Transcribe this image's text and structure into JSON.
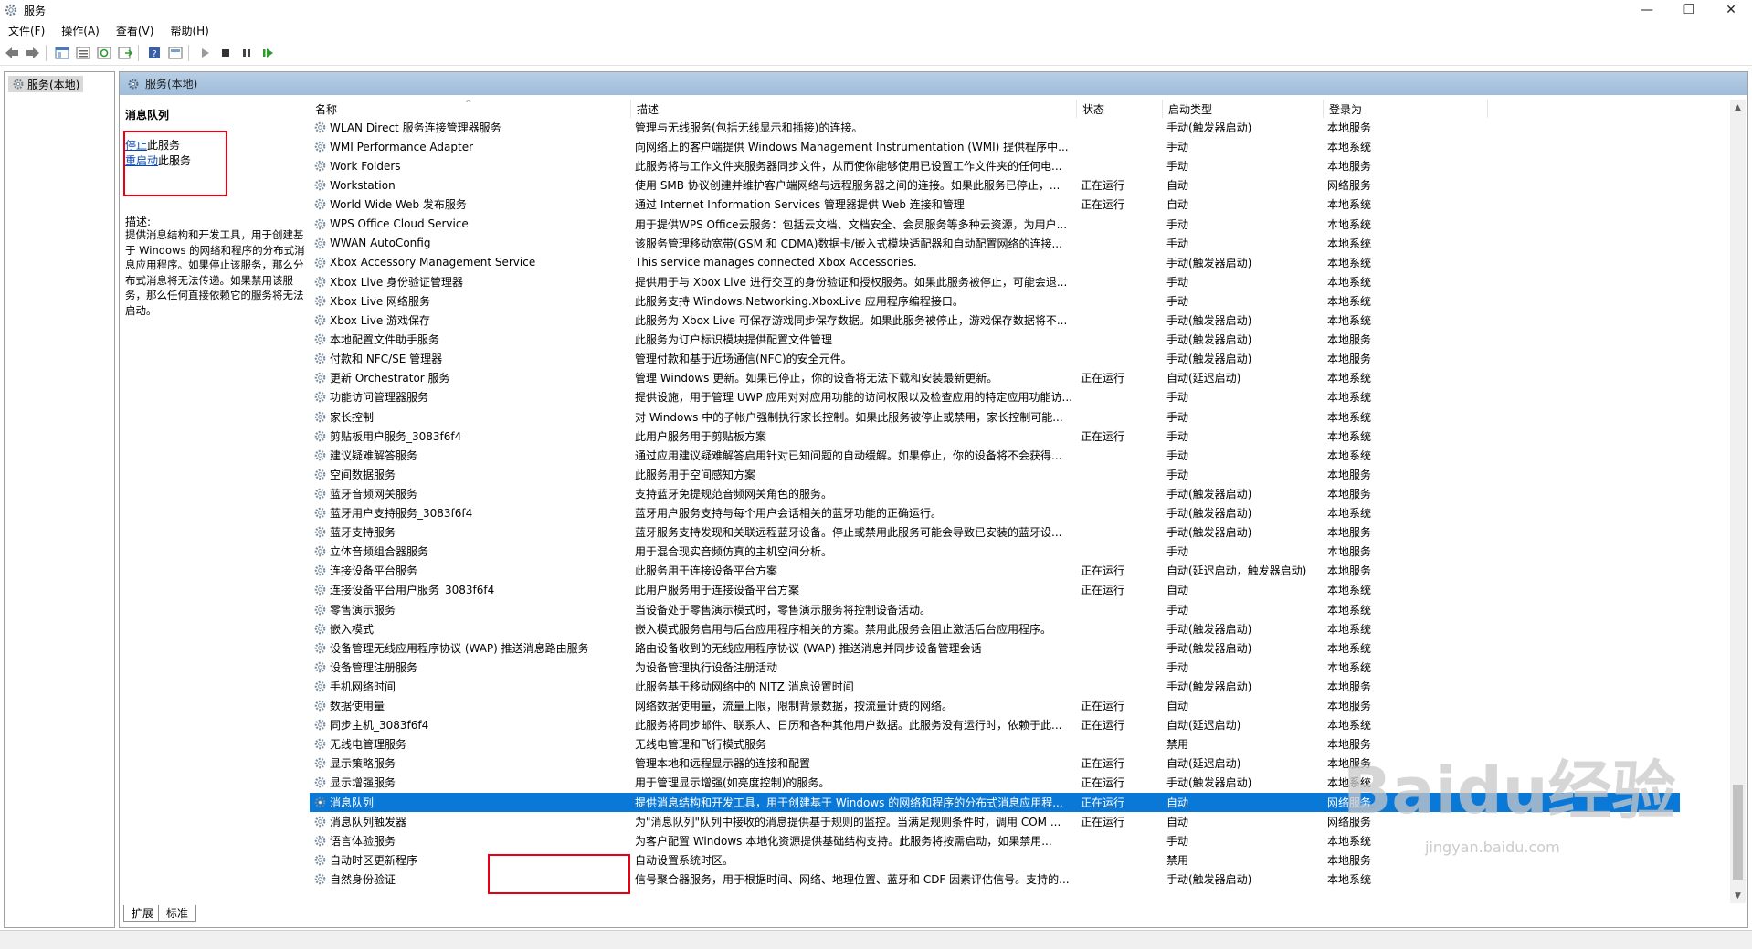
{
  "window": {
    "title": "服务",
    "minimize": "—",
    "restore": "❐",
    "close": "✕"
  },
  "menu": [
    "文件(F)",
    "操作(A)",
    "查看(V)",
    "帮助(H)"
  ],
  "tree": {
    "root_label": "服务(本地)"
  },
  "main": {
    "header_title": "服务(本地)"
  },
  "extended": {
    "selected_name": "消息队列",
    "stop_link": "停止",
    "stop_suffix": "此服务",
    "restart_link": "重启动",
    "restart_suffix": "此服务",
    "desc_label": "描述:",
    "description": "提供消息结构和开发工具，用于创建基于 Windows 的网络和程序的分布式消息应用程序。如果停止该服务，那么分布式消息将无法传递。如果禁用该服务，那么任何直接依赖它的服务将无法启动。"
  },
  "columns": {
    "name": "名称",
    "description": "描述",
    "status": "状态",
    "startup": "启动类型",
    "logon": "登录为"
  },
  "rows": [
    {
      "name": "WLAN Direct 服务连接管理器服务",
      "desc": "管理与无线服务(包括无线显示和插接)的连接。",
      "status": "",
      "startup": "手动(触发器启动)",
      "logon": "本地服务"
    },
    {
      "name": "WMI Performance Adapter",
      "desc": "向网络上的客户端提供 Windows Management Instrumentation (WMI) 提供程序中...",
      "status": "",
      "startup": "手动",
      "logon": "本地系统"
    },
    {
      "name": "Work Folders",
      "desc": "此服务将与工作文件夹服务器同步文件，从而使你能够使用已设置工作文件夹的任何电...",
      "status": "",
      "startup": "手动",
      "logon": "本地服务"
    },
    {
      "name": "Workstation",
      "desc": "使用 SMB 协议创建并维护客户端网络与远程服务器之间的连接。如果此服务已停止，...",
      "status": "正在运行",
      "startup": "自动",
      "logon": "网络服务"
    },
    {
      "name": "World Wide Web 发布服务",
      "desc": "通过 Internet Information Services 管理器提供 Web 连接和管理",
      "status": "正在运行",
      "startup": "自动",
      "logon": "本地系统"
    },
    {
      "name": "WPS Office Cloud Service",
      "desc": "用于提供WPS Office云服务：包括云文档、文档安全、会员服务等多种云资源，为用户...",
      "status": "",
      "startup": "手动",
      "logon": "本地系统"
    },
    {
      "name": "WWAN AutoConfig",
      "desc": "该服务管理移动宽带(GSM 和 CDMA)数据卡/嵌入式模块适配器和自动配置网络的连接...",
      "status": "",
      "startup": "手动",
      "logon": "本地系统"
    },
    {
      "name": "Xbox Accessory Management Service",
      "desc": "This service manages connected Xbox Accessories.",
      "status": "",
      "startup": "手动(触发器启动)",
      "logon": "本地系统"
    },
    {
      "name": "Xbox Live 身份验证管理器",
      "desc": "提供用于与 Xbox Live 进行交互的身份验证和授权服务。如果此服务被停止，可能会退...",
      "status": "",
      "startup": "手动",
      "logon": "本地系统"
    },
    {
      "name": "Xbox Live 网络服务",
      "desc": "此服务支持 Windows.Networking.XboxLive 应用程序编程接口。",
      "status": "",
      "startup": "手动",
      "logon": "本地系统"
    },
    {
      "name": "Xbox Live 游戏保存",
      "desc": "此服务为 Xbox Live 可保存游戏同步保存数据。如果此服务被停止，游戏保存数据将不...",
      "status": "",
      "startup": "手动(触发器启动)",
      "logon": "本地系统"
    },
    {
      "name": "本地配置文件助手服务",
      "desc": "此服务为订户标识模块提供配置文件管理",
      "status": "",
      "startup": "手动(触发器启动)",
      "logon": "本地服务"
    },
    {
      "name": "付款和 NFC/SE 管理器",
      "desc": "管理付款和基于近场通信(NFC)的安全元件。",
      "status": "",
      "startup": "手动(触发器启动)",
      "logon": "本地服务"
    },
    {
      "name": "更新 Orchestrator 服务",
      "desc": "管理 Windows 更新。如果已停止，你的设备将无法下载和安装最新更新。",
      "status": "正在运行",
      "startup": "自动(延迟启动)",
      "logon": "本地系统"
    },
    {
      "name": "功能访问管理器服务",
      "desc": "提供设施，用于管理 UWP 应用对对应用功能的访问权限以及检查应用的特定应用功能访...",
      "status": "",
      "startup": "手动",
      "logon": "本地系统"
    },
    {
      "name": "家长控制",
      "desc": "对 Windows 中的子帐户强制执行家长控制。如果此服务被停止或禁用，家长控制可能...",
      "status": "",
      "startup": "手动",
      "logon": "本地系统"
    },
    {
      "name": "剪贴板用户服务_3083f6f4",
      "desc": "此用户服务用于剪贴板方案",
      "status": "正在运行",
      "startup": "手动",
      "logon": "本地系统"
    },
    {
      "name": "建议疑难解答服务",
      "desc": "通过应用建议疑难解答启用针对已知问题的自动缓解。如果停止，你的设备将不会获得...",
      "status": "",
      "startup": "手动",
      "logon": "本地系统"
    },
    {
      "name": "空间数据服务",
      "desc": "此服务用于空间感知方案",
      "status": "",
      "startup": "手动",
      "logon": "本地服务"
    },
    {
      "name": "蓝牙音频网关服务",
      "desc": "支持蓝牙免提规范音频网关角色的服务。",
      "status": "",
      "startup": "手动(触发器启动)",
      "logon": "本地服务"
    },
    {
      "name": "蓝牙用户支持服务_3083f6f4",
      "desc": "蓝牙用户服务支持与每个用户会话相关的蓝牙功能的正确运行。",
      "status": "",
      "startup": "手动(触发器启动)",
      "logon": "本地系统"
    },
    {
      "name": "蓝牙支持服务",
      "desc": "蓝牙服务支持发现和关联远程蓝牙设备。停止或禁用此服务可能会导致已安装的蓝牙设...",
      "status": "",
      "startup": "手动(触发器启动)",
      "logon": "本地服务"
    },
    {
      "name": "立体音频组合器服务",
      "desc": "用于混合现实音频仿真的主机空间分析。",
      "status": "",
      "startup": "手动",
      "logon": "本地服务"
    },
    {
      "name": "连接设备平台服务",
      "desc": "此服务用于连接设备平台方案",
      "status": "正在运行",
      "startup": "自动(延迟启动，触发器启动)",
      "logon": "本地服务"
    },
    {
      "name": "连接设备平台用户服务_3083f6f4",
      "desc": "此用户服务用于连接设备平台方案",
      "status": "正在运行",
      "startup": "自动",
      "logon": "本地系统"
    },
    {
      "name": "零售演示服务",
      "desc": "当设备处于零售演示模式时，零售演示服务将控制设备活动。",
      "status": "",
      "startup": "手动",
      "logon": "本地系统"
    },
    {
      "name": "嵌入模式",
      "desc": "嵌入模式服务启用与后台应用程序相关的方案。禁用此服务会阻止激活后台应用程序。",
      "status": "",
      "startup": "手动(触发器启动)",
      "logon": "本地系统"
    },
    {
      "name": "设备管理无线应用程序协议 (WAP) 推送消息路由服务",
      "desc": "路由设备收到的无线应用程序协议 (WAP) 推送消息并同步设备管理会话",
      "status": "",
      "startup": "手动(触发器启动)",
      "logon": "本地系统"
    },
    {
      "name": "设备管理注册服务",
      "desc": "为设备管理执行设备注册活动",
      "status": "",
      "startup": "手动",
      "logon": "本地系统"
    },
    {
      "name": "手机网络时间",
      "desc": "此服务基于移动网络中的 NITZ 消息设置时间",
      "status": "",
      "startup": "手动(触发器启动)",
      "logon": "本地服务"
    },
    {
      "name": "数据使用量",
      "desc": "网络数据使用量，流量上限，限制背景数据，按流量计费的网络。",
      "status": "正在运行",
      "startup": "自动",
      "logon": "本地服务"
    },
    {
      "name": "同步主机_3083f6f4",
      "desc": "此服务将同步邮件、联系人、日历和各种其他用户数据。此服务没有运行时，依赖于此...",
      "status": "正在运行",
      "startup": "自动(延迟启动)",
      "logon": "本地系统"
    },
    {
      "name": "无线电管理服务",
      "desc": "无线电管理和飞行模式服务",
      "status": "",
      "startup": "禁用",
      "logon": "本地服务"
    },
    {
      "name": "显示策略服务",
      "desc": "管理本地和远程显示器的连接和配置",
      "status": "正在运行",
      "startup": "自动(延迟启动)",
      "logon": "本地服务"
    },
    {
      "name": "显示增强服务",
      "desc": "用于管理显示增强(如亮度控制)的服务。",
      "status": "正在运行",
      "startup": "手动(触发器启动)",
      "logon": "本地系统"
    },
    {
      "name": "消息队列",
      "desc": "提供消息结构和开发工具，用于创建基于 Windows 的网络和程序的分布式消息应用程...",
      "status": "正在运行",
      "startup": "自动",
      "logon": "网络服务",
      "selected": true
    },
    {
      "name": "消息队列触发器",
      "desc": "为\"消息队列\"队列中接收的消息提供基于规则的监控。当满足规则条件时，调用 COM ...",
      "status": "正在运行",
      "startup": "自动",
      "logon": "网络服务"
    },
    {
      "name": "语言体验服务",
      "desc": "为客户配置 Windows 本地化资源提供基础结构支持。此服务将按需启动，如果禁用...",
      "status": "",
      "startup": "手动",
      "logon": "本地系统"
    },
    {
      "name": "自动时区更新程序",
      "desc": "自动设置系统时区。",
      "status": "",
      "startup": "禁用",
      "logon": "本地服务"
    },
    {
      "name": "自然身份验证",
      "desc": "信号聚合器服务，用于根据时间、网络、地理位置、蓝牙和 CDF 因素评估信号。支持的...",
      "status": "",
      "startup": "手动(触发器启动)",
      "logon": "本地系统"
    }
  ],
  "tabs": [
    "扩展",
    "标准"
  ],
  "watermark": {
    "brand": "Baidu经验",
    "url": "jingyan.baidu.com"
  },
  "colors": {
    "selected_row": "#0a78d7",
    "highlight_box": "#e60012",
    "link": "#0645ad"
  }
}
